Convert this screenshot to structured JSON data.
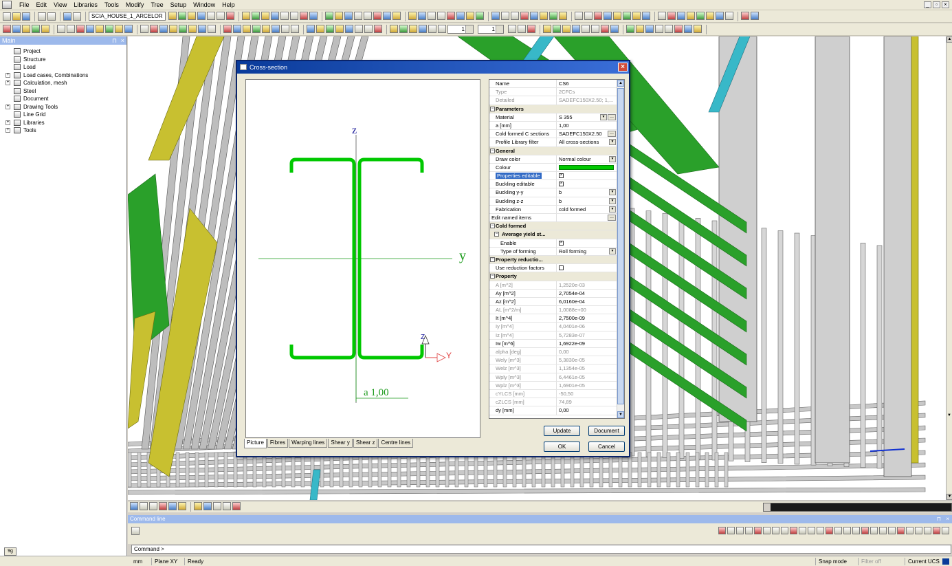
{
  "menubar": {
    "items": [
      "File",
      "Edit",
      "View",
      "Libraries",
      "Tools",
      "Modify",
      "Tree",
      "Setup",
      "Window",
      "Help"
    ]
  },
  "toolbar": {
    "project_combo": "SCIA_HOUSE_1_ARCELOR",
    "spin1": "1",
    "spin2": "1"
  },
  "main_panel": {
    "title": "Main",
    "items": [
      {
        "label": "Project",
        "icon": "project-icon",
        "expandable": false
      },
      {
        "label": "Structure",
        "icon": "structure-icon",
        "expandable": false
      },
      {
        "label": "Load",
        "icon": "load-icon",
        "expandable": false
      },
      {
        "label": "Load cases, Combinations",
        "icon": "load-cases-icon",
        "expandable": true
      },
      {
        "label": "Calculation, mesh",
        "icon": "calculation-icon",
        "expandable": true
      },
      {
        "label": "Steel",
        "icon": "steel-icon",
        "expandable": false
      },
      {
        "label": "Document",
        "icon": "document-icon",
        "expandable": false
      },
      {
        "label": "Drawing Tools",
        "icon": "drawing-tools-icon",
        "expandable": true
      },
      {
        "label": "Line Grid",
        "icon": "line-grid-icon",
        "expandable": false
      },
      {
        "label": "Libraries",
        "icon": "libraries-icon",
        "expandable": true
      },
      {
        "label": "Tools",
        "icon": "tools-icon",
        "expandable": true
      }
    ]
  },
  "dialog": {
    "title": "Cross-section",
    "picture": {
      "axis_z": "z",
      "axis_y": "y",
      "local_z": "Z",
      "local_y": "Y",
      "dimension": "a 1,00"
    },
    "tabs": [
      "Picture",
      "Fibres",
      "Warping lines",
      "Shear y",
      "Shear z",
      "Centre lines"
    ],
    "properties": [
      {
        "kind": "row",
        "name": "Name",
        "value": "CS6"
      },
      {
        "kind": "row",
        "name": "Type",
        "value": "2CFCs",
        "readonly": true
      },
      {
        "kind": "row",
        "name": "Detailed",
        "value": "SADEFC150X2.50; 1,...",
        "readonly": true
      },
      {
        "kind": "cat",
        "name": "Parameters"
      },
      {
        "kind": "row",
        "name": "Material",
        "value": "S 355",
        "dropdown": true,
        "ellipsis": true
      },
      {
        "kind": "row",
        "name": "a [mm]",
        "value": "1,00"
      },
      {
        "kind": "row",
        "name": "Cold formed C sections",
        "value": "SADEFC150X2.50",
        "ellipsis": true
      },
      {
        "kind": "row",
        "name": "Profile Library filter",
        "value": "All cross-sections",
        "dropdown": true
      },
      {
        "kind": "cat",
        "name": "General"
      },
      {
        "kind": "row",
        "name": "Draw color",
        "value": "Normal colour",
        "dropdown": true
      },
      {
        "kind": "row",
        "name": "Colour",
        "value": "",
        "swatch": "#00c800"
      },
      {
        "kind": "row",
        "name": "Properties editable",
        "value": "",
        "check": true,
        "selected": true
      },
      {
        "kind": "row",
        "name": "Buckling editable",
        "value": "",
        "check": true
      },
      {
        "kind": "row",
        "name": "Buckling y-y",
        "value": "b",
        "dropdown": true
      },
      {
        "kind": "row",
        "name": "Buckling z-z",
        "value": "b",
        "dropdown": true
      },
      {
        "kind": "row",
        "name": "Fabrication",
        "value": "cold formed",
        "dropdown": true
      },
      {
        "kind": "row",
        "name": "Edit named items",
        "value": "",
        "ellipsis": true,
        "noindent": true
      },
      {
        "kind": "cat",
        "name": "Cold formed"
      },
      {
        "kind": "cat",
        "name": "Average yield st...",
        "sub": true
      },
      {
        "kind": "row",
        "name": "Enable",
        "value": "",
        "check": true,
        "sub": true
      },
      {
        "kind": "row",
        "name": "Type of forming",
        "value": "Roll forming",
        "dropdown": true,
        "sub": true
      },
      {
        "kind": "cat",
        "name": "Property reductio..."
      },
      {
        "kind": "row",
        "name": "Use reduction factors",
        "value": "",
        "check": false
      },
      {
        "kind": "cat",
        "name": "Property"
      },
      {
        "kind": "row",
        "name": "A [m^2]",
        "value": "1,2520e-03",
        "readonly": true
      },
      {
        "kind": "row",
        "name": "Ay [m^2]",
        "value": "2,7054e-04"
      },
      {
        "kind": "row",
        "name": "Az [m^2]",
        "value": "6,0160e-04"
      },
      {
        "kind": "row",
        "name": "AL [m^2/m]",
        "value": "1,0088e+00",
        "readonly": true
      },
      {
        "kind": "row",
        "name": "It [m^4]",
        "value": "2,7500e-09"
      },
      {
        "kind": "row",
        "name": "Iy [m^4]",
        "value": "4,0401e-06",
        "readonly": true
      },
      {
        "kind": "row",
        "name": "Iz [m^4]",
        "value": "5,7283e-07",
        "readonly": true
      },
      {
        "kind": "row",
        "name": "Iw [m^6]",
        "value": "1,6922e-09"
      },
      {
        "kind": "row",
        "name": "alpha [deg]",
        "value": "0,00",
        "readonly": true
      },
      {
        "kind": "row",
        "name": "Wely [m^3]",
        "value": "5,3830e-05",
        "readonly": true
      },
      {
        "kind": "row",
        "name": "Welz [m^3]",
        "value": "1,1354e-05",
        "readonly": true
      },
      {
        "kind": "row",
        "name": "Wply [m^3]",
        "value": "6,4461e-05",
        "readonly": true
      },
      {
        "kind": "row",
        "name": "Wplz [m^3]",
        "value": "1,6901e-05",
        "readonly": true
      },
      {
        "kind": "row",
        "name": "cYLCS [mm]",
        "value": "-50,50",
        "readonly": true
      },
      {
        "kind": "row",
        "name": "cZLCS [mm]",
        "value": "74,89",
        "readonly": true
      },
      {
        "kind": "row",
        "name": "dy [mm]",
        "value": "0,00"
      }
    ],
    "buttons": {
      "update": "Update",
      "document": "Document",
      "ok": "OK",
      "cancel": "Cancel"
    }
  },
  "command_line": {
    "title": "Command line",
    "prompt": "Command >"
  },
  "statusbar": {
    "units": "mm",
    "plane": "Plane XY",
    "state": "Ready",
    "snap": "Snap mode",
    "filter": "Filter off",
    "ucs": "Current UCS"
  },
  "main_tab_label": "9g",
  "colors": {
    "section_green": "#00c800",
    "beam_green": "#2aa02a",
    "beam_yellow": "#c8c030",
    "axis_blue": "#1a1a9a",
    "axis_green": "#1a9a1a",
    "title_blue": "#0a3b9a"
  }
}
